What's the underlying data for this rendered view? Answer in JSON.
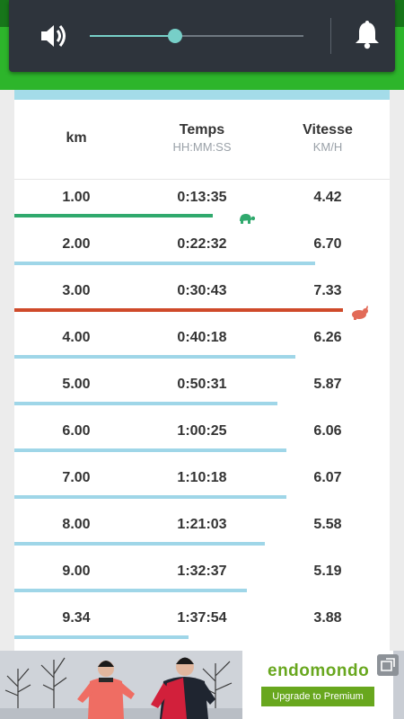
{
  "volume": {
    "level": 0.4,
    "speaker_icon": "speaker-volume-icon",
    "bell_icon": "notification-bell-icon",
    "accent": "#77cfc8"
  },
  "table": {
    "headers": {
      "km": "km",
      "time": "Temps",
      "time_unit": "HH:MM:SS",
      "speed": "Vitesse",
      "speed_unit": "KM/H"
    },
    "rows": [
      {
        "km": "1.00",
        "time": "0:13:35",
        "speed": "4.42",
        "marker": "slowest"
      },
      {
        "km": "2.00",
        "time": "0:22:32",
        "speed": "6.70",
        "marker": ""
      },
      {
        "km": "3.00",
        "time": "0:30:43",
        "speed": "7.33",
        "marker": "fastest"
      },
      {
        "km": "4.00",
        "time": "0:40:18",
        "speed": "6.26",
        "marker": ""
      },
      {
        "km": "5.00",
        "time": "0:50:31",
        "speed": "5.87",
        "marker": ""
      },
      {
        "km": "6.00",
        "time": "1:00:25",
        "speed": "6.06",
        "marker": ""
      },
      {
        "km": "7.00",
        "time": "1:10:18",
        "speed": "6.07",
        "marker": ""
      },
      {
        "km": "8.00",
        "time": "1:21:03",
        "speed": "5.58",
        "marker": ""
      },
      {
        "km": "9.00",
        "time": "1:32:37",
        "speed": "5.19",
        "marker": ""
      },
      {
        "km": "9.34",
        "time": "1:37:54",
        "speed": "3.88",
        "marker": ""
      }
    ],
    "colors": {
      "normal_bar": "#9fd6e8",
      "slowest_bar": "#30a96d",
      "fastest_bar": "#cf4a2a",
      "turtle": "#30a96d",
      "rabbit": "#e26a57"
    }
  },
  "ad": {
    "brand": "endomondo",
    "cta": "Upgrade to Premium",
    "brand_color": "#68a71e"
  }
}
